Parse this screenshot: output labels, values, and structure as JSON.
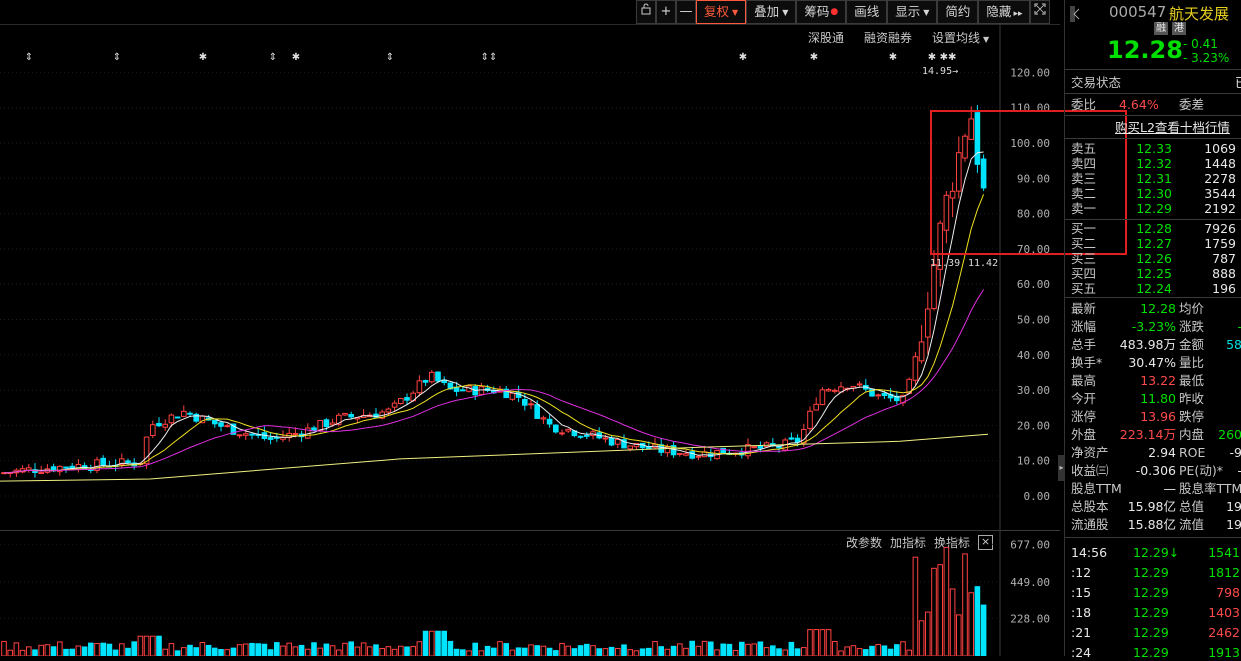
{
  "toolbar": {
    "lock_icon": "lock-icon",
    "plus_icon": "+",
    "minus_icon": "—",
    "fuquan": "复权",
    "diejia": "叠加",
    "chouma": "筹码",
    "huaxian": "画线",
    "xianshi": "显示",
    "jianyue": "简约",
    "yincang": "隐藏",
    "forward_icon": "▸▸",
    "expand_icon": "⤢"
  },
  "ma_bar": {
    "shengu": "深股通",
    "rongzi": "融资融券",
    "shezhi": "设置均线"
  },
  "sub_bar": {
    "gaicanshu": "改参数",
    "jiazhibiao": "加指标",
    "huanzhibiao": "换指标",
    "close": "×"
  },
  "chart_data": {
    "type": "candlestick",
    "ylim": [
      0,
      125
    ],
    "y_ticks": [
      "120.00",
      "110.00",
      "100.00",
      "90.00",
      "80.00",
      "70.00",
      "60.00",
      "50.00",
      "40.00",
      "30.00",
      "20.00",
      "10.00",
      "0.00"
    ],
    "vol_ticks": [
      "677.00",
      "449.00",
      "228.00"
    ],
    "annotations": {
      "high": "14.95",
      "low_left": "11.39",
      "low_right": "11.42"
    }
  },
  "quote": {
    "code": "000547",
    "name": "航天发展",
    "badge_rong": "融",
    "badge_gang": "港",
    "price": "12.28",
    "change": "- 0.41",
    "change_pct": "- 3.23%",
    "trade_status_label": "交易状态",
    "trade_status_value": "已",
    "weibi_label": "委比",
    "weibi_value": "4.64%",
    "weicha_label": "委差",
    "l2_link": "购买L2查看十档行情"
  },
  "asks": [
    {
      "label": "卖五",
      "price": "12.33",
      "vol": "1069"
    },
    {
      "label": "卖四",
      "price": "12.32",
      "vol": "1448"
    },
    {
      "label": "卖三",
      "price": "12.31",
      "vol": "2278"
    },
    {
      "label": "卖二",
      "price": "12.30",
      "vol": "3544"
    },
    {
      "label": "卖一",
      "price": "12.29",
      "vol": "2192"
    }
  ],
  "bids": [
    {
      "label": "买一",
      "price": "12.28",
      "vol": "7926"
    },
    {
      "label": "买二",
      "price": "12.27",
      "vol": "1759"
    },
    {
      "label": "买三",
      "price": "12.26",
      "vol": "787"
    },
    {
      "label": "买四",
      "price": "12.25",
      "vol": "888"
    },
    {
      "label": "买五",
      "price": "12.24",
      "vol": "196"
    }
  ],
  "stats": [
    {
      "l1": "最新",
      "v1": "12.28",
      "c1": "green",
      "l2": "均价",
      "v2": "",
      "c2": "white"
    },
    {
      "l1": "涨幅",
      "v1": "-3.23%",
      "c1": "green",
      "l2": "涨跌",
      "v2": "-",
      "c2": "green"
    },
    {
      "l1": "总手",
      "v1": "483.98万",
      "c1": "white",
      "l2": "金额",
      "v2": "58",
      "c2": "cyan"
    },
    {
      "l1": "换手*",
      "v1": "30.47%",
      "c1": "white",
      "l2": "量比",
      "v2": "",
      "c2": "white"
    },
    {
      "l1": "最高",
      "v1": "13.22",
      "c1": "red",
      "l2": "最低",
      "v2": "",
      "c2": "white"
    },
    {
      "l1": "今开",
      "v1": "11.80",
      "c1": "green",
      "l2": "昨收",
      "v2": "",
      "c2": "white"
    },
    {
      "l1": "涨停",
      "v1": "13.96",
      "c1": "red",
      "l2": "跌停",
      "v2": "",
      "c2": "white"
    },
    {
      "l1": "外盘",
      "v1": "223.14万",
      "c1": "red",
      "l2": "内盘",
      "v2": "260",
      "c2": "green"
    },
    {
      "l1": "净资产",
      "v1": "2.94",
      "c1": "white",
      "l2": "ROE",
      "v2": "-9",
      "c2": "white"
    },
    {
      "l1": "收益㈢",
      "v1": "-0.306",
      "c1": "white",
      "l2": "PE(动)*",
      "v2": "-",
      "c2": "white"
    },
    {
      "l1": "股息TTM",
      "v1": "—",
      "c1": "white",
      "l2": "股息率TTM",
      "v2": "",
      "c2": "white"
    },
    {
      "l1": "总股本",
      "v1": "15.98亿",
      "c1": "white",
      "l2": "总值",
      "v2": "19",
      "c2": "white"
    },
    {
      "l1": "流通股",
      "v1": "15.88亿",
      "c1": "white",
      "l2": "流值",
      "v2": "19",
      "c2": "white"
    }
  ],
  "ticks": [
    {
      "time": "14:56",
      "price": "12.29↓",
      "vol": "1541",
      "vc": "green"
    },
    {
      "time": ":12",
      "price": "12.29",
      "vol": "1812",
      "vc": "green"
    },
    {
      "time": ":15",
      "price": "12.29",
      "vol": "798",
      "vc": "red"
    },
    {
      "time": ":18",
      "price": "12.29",
      "vol": "1403",
      "vc": "red"
    },
    {
      "time": ":21",
      "price": "12.29",
      "vol": "2462",
      "vc": "red"
    },
    {
      "time": ":24",
      "price": "12.29",
      "vol": "1913",
      "vc": "green"
    }
  ]
}
